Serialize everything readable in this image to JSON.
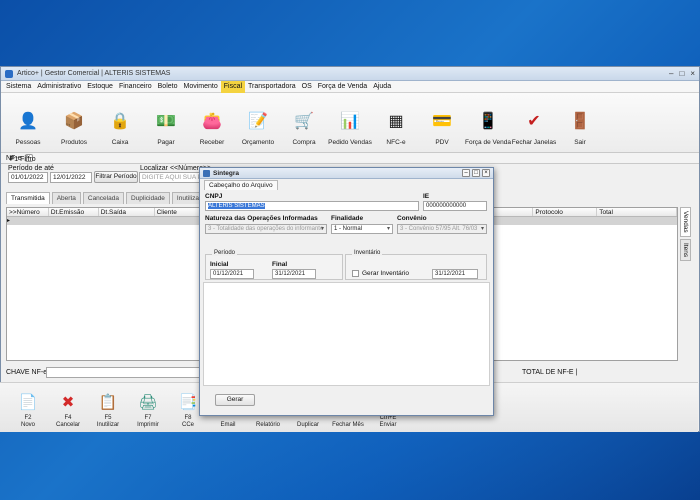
{
  "window": {
    "title": "Artico+ | Gestor Comercial | ALTERIS SISTEMAS",
    "controls": [
      "–",
      "□",
      "×"
    ]
  },
  "menu": [
    "Sistema",
    "Administrativo",
    "Estoque",
    "Financeiro",
    "Boleto",
    "Movimento",
    "Fiscal",
    "Transportadora",
    "OS",
    "Força de Venda",
    "Ajuda"
  ],
  "menu_active": "Fiscal",
  "toolbar": [
    {
      "label": "Pessoas",
      "icon": "people-icon",
      "glyph": "👤"
    },
    {
      "label": "Produtos",
      "icon": "box-icon",
      "glyph": "📦"
    },
    {
      "label": "Caixa",
      "icon": "safe-icon",
      "glyph": "🔒"
    },
    {
      "label": "Pagar",
      "icon": "money-out-icon",
      "glyph": "💵"
    },
    {
      "label": "Receber",
      "icon": "wallet-icon",
      "glyph": "👛"
    },
    {
      "label": "Orçamento",
      "icon": "clipboard-icon",
      "glyph": "📝"
    },
    {
      "label": "Compra",
      "icon": "cart-icon",
      "glyph": "🛒"
    },
    {
      "label": "Pedido Vendas",
      "icon": "chart-icon",
      "glyph": "📊"
    },
    {
      "label": "NFC-e",
      "icon": "qrcode-icon",
      "glyph": "▦"
    },
    {
      "label": "PDV",
      "icon": "card-terminal-icon",
      "glyph": "💳"
    },
    {
      "label": "Força de Venda",
      "icon": "phone-icon",
      "glyph": "📱"
    },
    {
      "label": "Fechar Janelas",
      "icon": "check-icon",
      "glyph": "✔"
    },
    {
      "label": "Sair",
      "icon": "exit-door-icon",
      "glyph": "🚪"
    }
  ],
  "doc_tab": {
    "label": "NF-e",
    "close": "×"
  },
  "filters": {
    "section": "F1 Filtro",
    "period_label": "Período de  até",
    "date_from": "01/01/2022",
    "date_to": "12/01/2022",
    "filter_button": "Filtrar Período",
    "search_label": "Localizar <<Número>>",
    "search_placeholder": "DIGITE AQUI SUA PES"
  },
  "subtabs": [
    "Transmitida",
    "Aberta",
    "Cancelada",
    "Duplicidade",
    "Inutilizada"
  ],
  "subtab_active": "Transmitida",
  "grid": {
    "columns": [
      ">>Número",
      "Dt.Emissão",
      "Dt.Saída",
      "Cliente",
      "Protocolo",
      "Total"
    ],
    "row_marker": "▸"
  },
  "side_tabs": [
    "Vendas",
    "Itens"
  ],
  "chave_label": "CHAVE NF-e:",
  "total_label": "TOTAL DE NF-E  |",
  "bottom_buttons": [
    {
      "key": "F2",
      "label": "Novo",
      "icon": "new-document-icon",
      "glyph": "📄"
    },
    {
      "key": "F4",
      "label": "Cancelar",
      "icon": "cancel-x-icon",
      "glyph": "✖"
    },
    {
      "key": "F5",
      "label": "Inutilizar",
      "icon": "checklist-icon",
      "glyph": "📋"
    },
    {
      "key": "F7",
      "label": "Imprimir",
      "icon": "printer-icon",
      "glyph": "🖨"
    },
    {
      "key": "F8",
      "label": "CCe",
      "icon": "cce-icon",
      "glyph": "📑"
    },
    {
      "key": "",
      "label": "Email",
      "icon": "email-icon",
      "glyph": ""
    },
    {
      "key": "",
      "label": "Relatório",
      "icon": "report-icon",
      "glyph": ""
    },
    {
      "key": "",
      "label": "Duplicar",
      "icon": "duplicate-icon",
      "glyph": ""
    },
    {
      "key": "",
      "label": "Fechar Mês",
      "icon": "close-month-icon",
      "glyph": ""
    },
    {
      "key": "Ctrl+E",
      "label": "Enviar",
      "icon": "send-icon",
      "glyph": ""
    }
  ],
  "dialog": {
    "title": "Sintegra",
    "tab": "Cabeçalho do Arquivo",
    "cnpj_label": "CNPJ",
    "cnpj_value": "ALTERIS SISTEMAS",
    "ie_label": "IE",
    "ie_value": "000000000000",
    "natureza_label": "Natureza das Operações Informadas",
    "natureza_value": "3 - Totalidade das operações do informante",
    "finalidade_label": "Finalidade",
    "finalidade_value": "1 - Normal",
    "convenio_label": "Convênio",
    "convenio_value": "3 - Convênio 57/95 Alt. 76/03",
    "periodo_group": "Período",
    "inicial_label": "Inicial",
    "inicial_value": "01/12/2021",
    "final_label": "Final",
    "final_value": "31/12/2021",
    "inventario_group": "Inventário",
    "gerar_inventario_label": "Gerar Inventário",
    "inventario_date": "31/12/2021",
    "gerar_button": "Gerar"
  }
}
